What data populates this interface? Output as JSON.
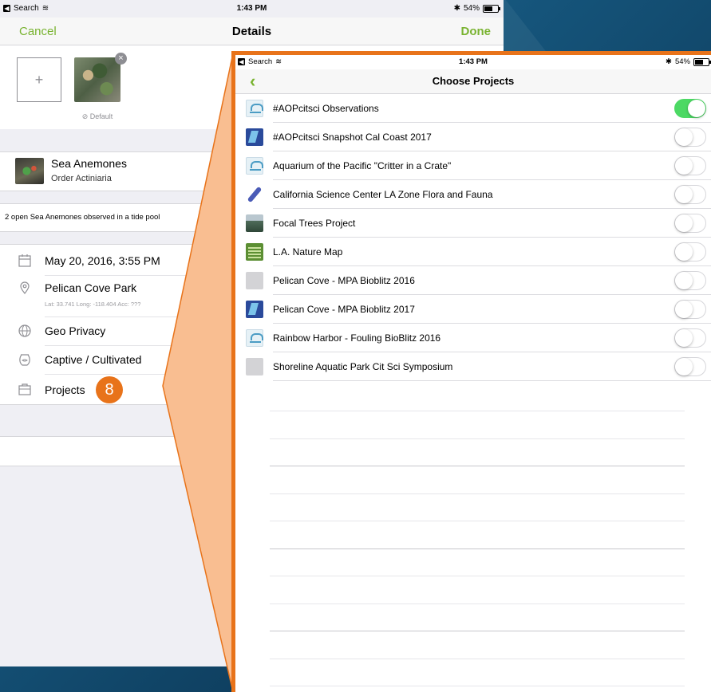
{
  "back_screen": {
    "status": {
      "carrier": "Search",
      "time": "1:43 PM",
      "battery": "54%"
    },
    "nav": {
      "cancel": "Cancel",
      "title": "Details",
      "done": "Done"
    },
    "photos": {
      "add": "+",
      "remove": "×",
      "default_label": "⊘ Default"
    },
    "species": {
      "name": "Sea Anemones",
      "taxon": "Order Actiniaria"
    },
    "notes": "2 open Sea Anemones observed in a tide pool",
    "date": "May 20, 2016, 3:55 PM",
    "location": "Pelican Cove Park",
    "coords": "Lat: 33.741  Long: -118.404  Acc: ???",
    "geo_privacy": "Geo Privacy",
    "captive": "Captive / Cultivated",
    "projects": "Projects"
  },
  "callout_badge": "8",
  "zoom_screen": {
    "status": {
      "carrier": "Search",
      "time": "1:43 PM",
      "battery": "54%"
    },
    "nav": {
      "back": "‹",
      "title": "Choose Projects"
    },
    "projects": [
      {
        "name": "#AOPcitsci Observations",
        "icon": "aop-logo-icon",
        "on": true
      },
      {
        "name": "#AOPcitsci Snapshot Cal Coast 2017",
        "icon": "snapshot-cal-icon",
        "on": false
      },
      {
        "name": "Aquarium of the Pacific \"Critter in a Crate\"",
        "icon": "aop-logo-icon",
        "on": false
      },
      {
        "name": "California Science Center LA Zone Flora and Fauna",
        "icon": "csc-icon",
        "on": false
      },
      {
        "name": "Focal Trees Project",
        "icon": "focal-trees-icon",
        "on": false
      },
      {
        "name": "L.A. Nature Map",
        "icon": "la-nature-map-icon",
        "on": false
      },
      {
        "name": "Pelican Cove - MPA Bioblitz 2016",
        "icon": "placeholder-icon",
        "on": false
      },
      {
        "name": "Pelican Cove - MPA Bioblitz 2017",
        "icon": "snapshot-cal-icon",
        "on": false
      },
      {
        "name": "Rainbow Harbor - Fouling BioBlitz 2016",
        "icon": "aop-logo-icon",
        "on": false
      },
      {
        "name": "Shoreline Aquatic Park Cit Sci Symposium",
        "icon": "placeholder-icon",
        "on": false
      }
    ]
  },
  "colors": {
    "accent_green": "#79b330",
    "toggle_on": "#4cd964",
    "callout_orange": "#e8731a",
    "callout_fill": "#f9be91"
  }
}
